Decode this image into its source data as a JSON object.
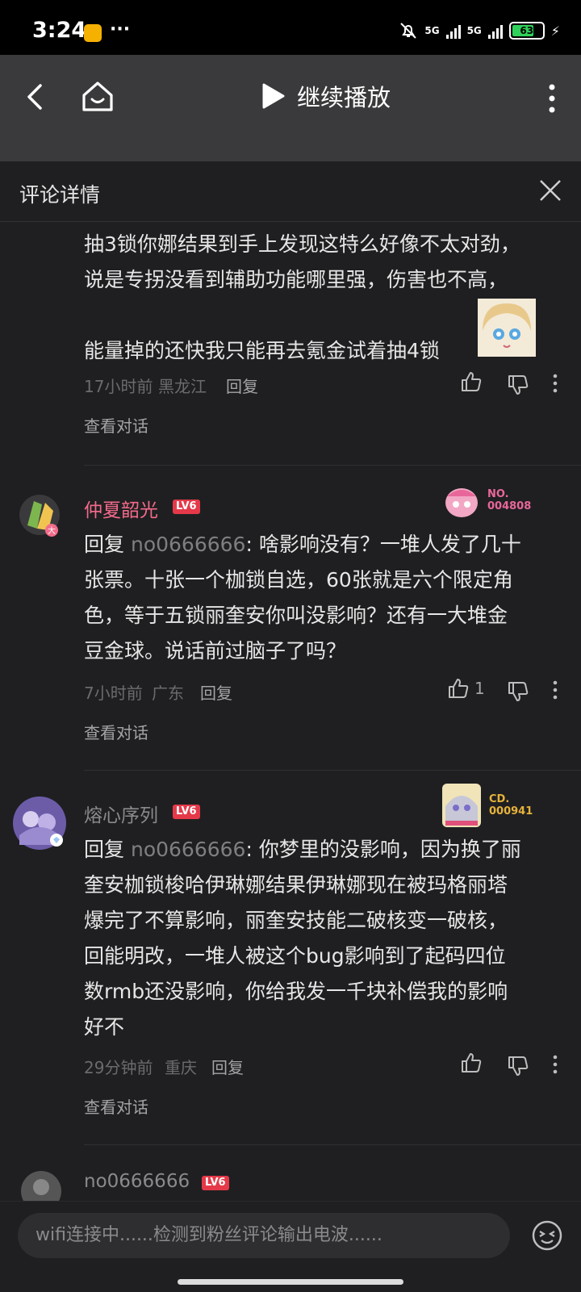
{
  "status_bar": {
    "time": "3:24",
    "dots": "···",
    "net1": "5G",
    "net2": "5G",
    "battery": "63"
  },
  "nav": {
    "title": "继续播放"
  },
  "header": {
    "label": "评论详情"
  },
  "comments": [
    {
      "lines": [
        "抽3锁你娜结果到手上发现这特么好像不太对劲，",
        "说是专拐没看到辅助功能哪里强，伤害也不高，",
        "",
        "能量掉的还快我只能再去氪金试着抽4锁"
      ],
      "time": "17小时前",
      "loc": "黑龙江",
      "reply": "回复",
      "like_count": "",
      "view": "查看对话"
    },
    {
      "username": "仲夏韶光",
      "level": "LV6",
      "badge_line1": "NO.",
      "badge_line2": "004808",
      "reply_prefix": "回复",
      "reply_to": "no0666666",
      "lines": [
        "回复 no0666666: 啥影响没有？一堆人发了几十",
        "张票。十张一个枷锁自选，60张就是六个限定角",
        "色，等于五锁丽奎安你叫没影响？还有一大堆金",
        "豆金球。说话前过脑子了吗？"
      ],
      "time": "7小时前",
      "loc": "广东",
      "reply": "回复",
      "like_count": "1",
      "view": "查看对话"
    },
    {
      "username": "熔心序列",
      "level": "LV6",
      "badge_line1": "CD.",
      "badge_line2": "000941",
      "reply_prefix": "回复",
      "reply_to": "no0666666",
      "lines": [
        "回复 no0666666: 你梦里的没影响，因为换了丽",
        "奎安枷锁梭哈伊琳娜结果伊琳娜现在被玛格丽塔",
        "爆完了不算影响，丽奎安技能二破核变一破核，",
        "回能明改，一堆人被这个bug影响到了起码四位",
        "数rmb还没影响，你给我发一千块补偿我的影响",
        "好不"
      ],
      "time": "29分钟前",
      "loc": "重庆",
      "reply": "回复",
      "like_count": "",
      "view": "查看对话"
    },
    {
      "username": "no0666666",
      "level": "LV6"
    }
  ],
  "input": {
    "placeholder": "wifi连接中......检测到粉丝评论输出电波......"
  },
  "colors": {
    "accent_pink": "#f36b8b",
    "level_red": "#e53949",
    "badge_gold": "#e6b23a",
    "badge_pink": "#e8679a"
  }
}
